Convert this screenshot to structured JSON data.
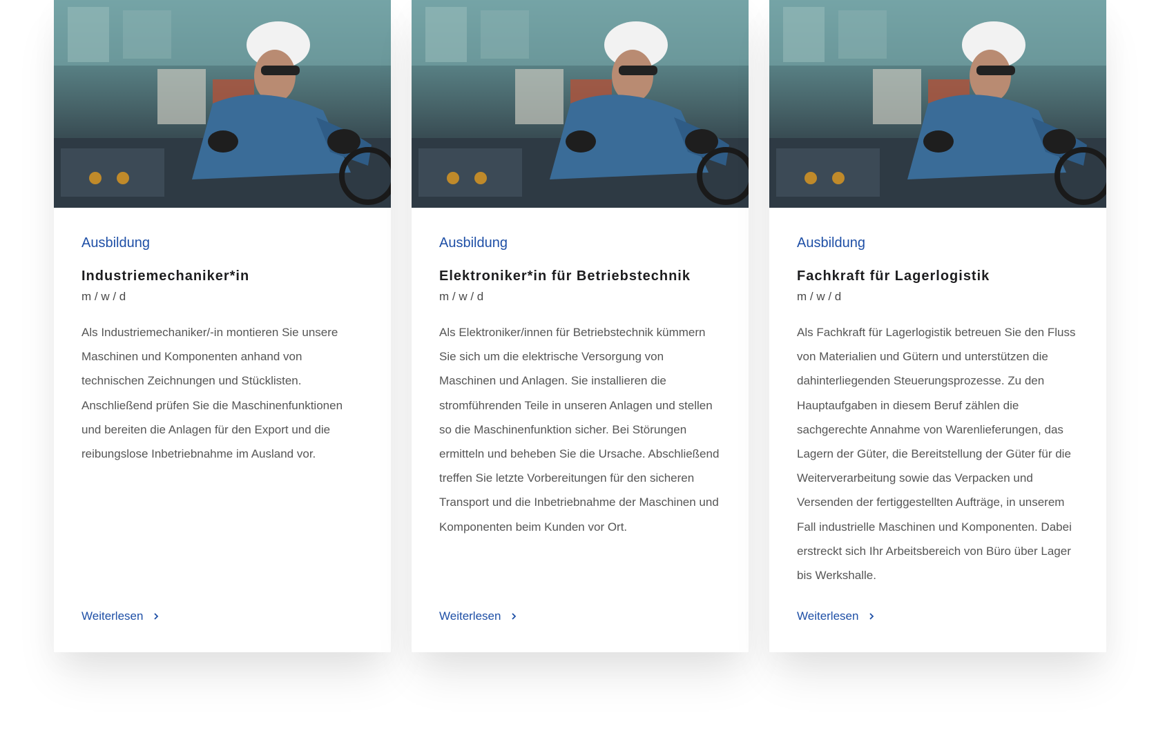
{
  "cards": [
    {
      "category": "Ausbildung",
      "title": "Industriemechaniker*in",
      "gender": "m / w / d",
      "description": "Als Industriemechaniker/-in montieren Sie unsere Maschinen und Komponenten anhand von technischen Zeichnungen und Stücklisten. Anschließend prüfen Sie die Maschinenfunktionen und bereiten die Anlagen für den Export und die reibungslose Inbetriebnahme im Ausland vor.",
      "read_more": "Weiterlesen"
    },
    {
      "category": "Ausbildung",
      "title": "Elektroniker*in für Betriebstechnik",
      "gender": "m / w / d",
      "description": "Als Elektroniker/innen für Betriebstechnik kümmern Sie sich um die elektrische Versorgung von Maschinen und Anlagen. Sie installieren die stromführenden Teile in unseren Anlagen und stellen so die Maschinenfunktion sicher. Bei Störungen ermitteln und beheben Sie die Ursache. Abschließend treffen Sie letzte Vorbereitungen für den sicheren Transport und die Inbetriebnahme der Maschinen und Komponenten beim Kunden vor Ort.",
      "read_more": "Weiterlesen"
    },
    {
      "category": "Ausbildung",
      "title": "Fachkraft für Lagerlogistik",
      "gender": "m / w / d",
      "description": "Als Fachkraft für Lagerlogistik betreuen Sie den Fluss von Materialien und Gütern und unterstützen die dahinterliegenden Steuerungsprozesse. Zu den Hauptaufgaben in diesem Beruf zählen die sachgerechte Annahme von Warenlieferungen, das Lagern der Güter, die Bereitstellung der Güter für die Weiterverarbeitung sowie das Verpacken und Versenden der fertiggestellten Aufträge, in unserem Fall industrielle Maschinen und Komponenten. Dabei erstreckt sich Ihr Arbeitsbereich von Büro über Lager bis Werkshalle.",
      "read_more": "Weiterlesen"
    }
  ],
  "colors": {
    "accent": "#1e4fa6",
    "title": "#1d1d1f",
    "body_text": "#555555"
  },
  "icons": {
    "read_more": "chevron-right-icon",
    "image": "factory-worker-photo"
  }
}
